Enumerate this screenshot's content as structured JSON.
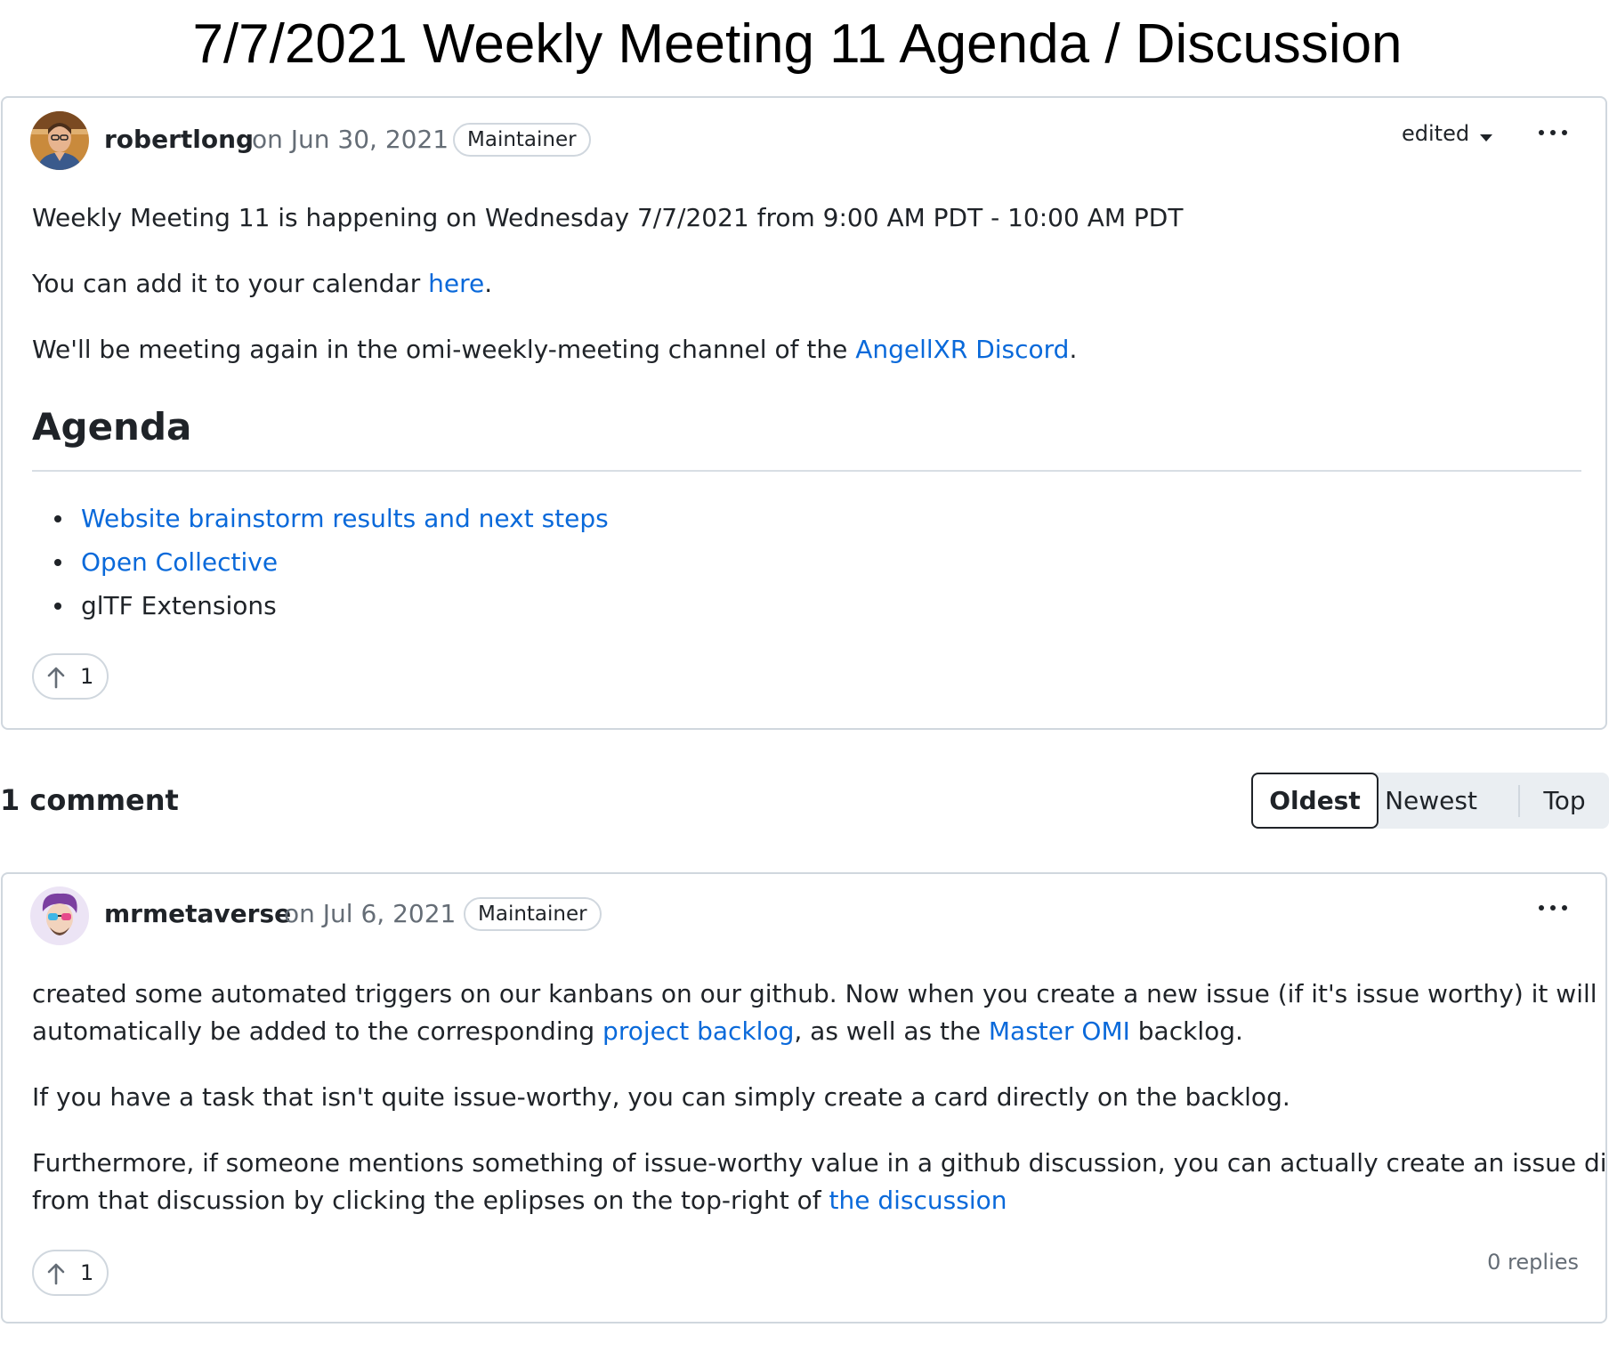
{
  "page_title": "7/7/2021 Weekly Meeting 11 Agenda / Discussion",
  "post": {
    "author": "robertlong",
    "date": "on Jun 30, 2021",
    "badge": "Maintainer",
    "edited_label": "edited",
    "line1": "Weekly Meeting 11 is happening on Wednesday 7/7/2021 from 9:00 AM PDT - 10:00 AM PDT",
    "line2_prefix": "You can add it to your calendar ",
    "line2_link": "here",
    "line2_suffix": ".",
    "line3_prefix": "We'll be meeting again in the omi-weekly-meeting channel of the ",
    "line3_link": "AngellXR Discord",
    "line3_suffix": ".",
    "agenda_heading": "Agenda",
    "agenda_items": [
      {
        "text": "Website brainstorm results and next steps",
        "link": true
      },
      {
        "text": "Open Collective",
        "link": true
      },
      {
        "text": "glTF Extensions",
        "link": false
      }
    ],
    "upvotes": "1"
  },
  "comments_header": {
    "count_label": "1 comment",
    "sort_options": [
      "Oldest",
      "Newest",
      "Top"
    ],
    "active_sort": "Oldest"
  },
  "comment": {
    "author": "mrmetaverse",
    "date": "on Jul 6, 2021",
    "badge": "Maintainer",
    "p1_line1": "created some automated triggers on our kanbans on our github. Now when you create a new issue (if it's issue worthy) it will",
    "p1_line2_a": "automatically be added to the corresponding ",
    "p1_link1": "project backlog",
    "p1_line2_b": ", as well as the ",
    "p1_link2": "Master OMI",
    "p1_line2_c": " backlog.",
    "p2": "If you have a task that isn't quite issue-worthy, you can simply create a card directly on the backlog.",
    "p3_line1": "Furthermore, if someone mentions something of issue-worthy value in a github discussion, you can actually create an issue directly",
    "p3_line2_a": "from that discussion by clicking the eplipses on the top-right of ",
    "p3_link": "the discussion",
    "upvotes": "1",
    "replies": "0 replies"
  },
  "icons": {
    "upvote": "arrow-up-icon",
    "menu": "kebab-menu-icon",
    "dropdown": "caret-down-icon"
  },
  "colors": {
    "link": "#0969da",
    "border": "#d0d7de",
    "muted_text": "#656d76",
    "text": "#1f2328"
  }
}
